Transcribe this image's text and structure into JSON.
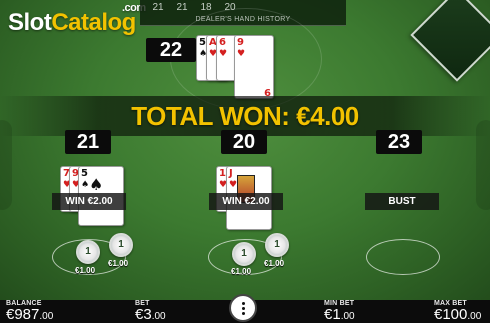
{
  "logo": {
    "main": "Slot",
    "accent": "Catalog",
    "suffix": ".com"
  },
  "history": {
    "values": [
      "21",
      "21",
      "18",
      "20"
    ],
    "title": "DEALER'S HAND HISTORY"
  },
  "dealer": {
    "score": "22",
    "cards": [
      {
        "rank": "5",
        "suit": "♠",
        "color": "black"
      },
      {
        "rank": "A",
        "suit": "♥",
        "color": "red"
      },
      {
        "rank": "6",
        "suit": "♥",
        "color": "red"
      },
      {
        "rank": "9",
        "suit": "♥",
        "color": "red"
      }
    ]
  },
  "banner": {
    "text": "TOTAL WON: €4.00"
  },
  "hands": [
    {
      "score": "21",
      "result": "WIN  €2.00",
      "cards": [
        {
          "rank": "7",
          "suit": "♥",
          "color": "red"
        },
        {
          "rank": "9",
          "suit": "♥",
          "color": "red"
        },
        {
          "rank": "5",
          "suit": "♠",
          "color": "black"
        }
      ],
      "chips": [
        {
          "value": "1",
          "label": "€1.00"
        },
        {
          "value": "1",
          "label": "€1.00"
        }
      ]
    },
    {
      "score": "20",
      "result": "WIN  €2.00",
      "cards": [
        {
          "rank": "10",
          "suit": "♥",
          "color": "red"
        },
        {
          "rank": "J",
          "suit": "♥",
          "color": "red"
        }
      ],
      "chips": [
        {
          "value": "1",
          "label": "€1.00"
        },
        {
          "value": "1",
          "label": "€1.00"
        }
      ]
    },
    {
      "score": "23",
      "result": "BUST",
      "cards": [],
      "chips": []
    }
  ],
  "bottom_bar": {
    "balance_label": "BALANCE",
    "balance_value": "€987",
    "balance_cents": ".00",
    "bet_label": "BET",
    "bet_value": "€3",
    "bet_cents": ".00",
    "min_bet_label": "MIN BET",
    "min_bet_value": "€1",
    "min_bet_cents": ".00",
    "max_bet_label": "MAX BET",
    "max_bet_value": "€100",
    "max_bet_cents": ".00"
  },
  "colors": {
    "felt": "#3c7a30",
    "accent": "#f2c200",
    "bar": "#0c0c0c"
  },
  "icons": {
    "menu": "menu-dots-icon",
    "shoe": "card-shoe-icon"
  }
}
